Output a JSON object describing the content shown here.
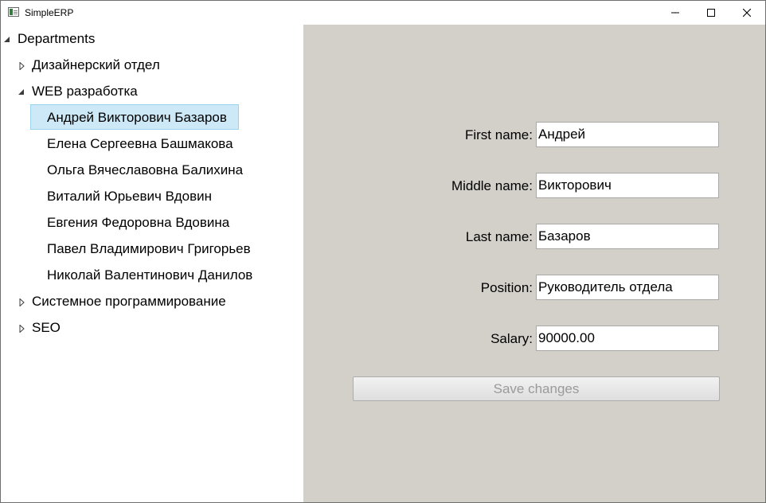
{
  "window": {
    "title": "SimpleERP"
  },
  "tree": {
    "root": "Departments",
    "departments": [
      {
        "label": "Дизайнерский отдел",
        "expanded": false
      },
      {
        "label": "WEB разработка",
        "expanded": true,
        "employees": [
          "Андрей Викторович Базаров",
          "Елена Сергеевна Башмакова",
          "Ольга Вячеславовна Балихина",
          "Виталий Юрьевич Вдовин",
          "Евгения Федоровна Вдовина",
          "Павел Владимирович Григорьев",
          "Николай Валентинович Данилов"
        ],
        "selected_index": 0
      },
      {
        "label": "Системное программирование",
        "expanded": false
      },
      {
        "label": "SEO",
        "expanded": false
      }
    ]
  },
  "form": {
    "first_name_label": "First name:",
    "first_name_value": "Андрей",
    "middle_name_label": "Middle name:",
    "middle_name_value": "Викторович",
    "last_name_label": "Last name:",
    "last_name_value": "Базаров",
    "position_label": "Position:",
    "position_value": "Руководитель отдела",
    "salary_label": "Salary:",
    "salary_value": "90000.00",
    "save_label": "Save changes"
  },
  "colors": {
    "selection_bg": "#cde8f6",
    "selection_border": "#9bd3ee",
    "detail_panel_bg": "#d3cfc9"
  }
}
